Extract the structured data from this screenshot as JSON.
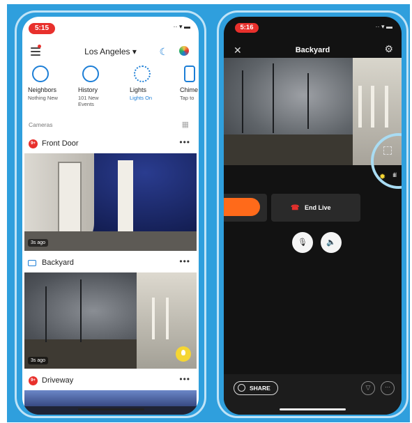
{
  "left_phone": {
    "status_time": "5:15",
    "location": "Los Angeles",
    "features": [
      {
        "name": "Neighbors",
        "sub": "Nothing New"
      },
      {
        "name": "History",
        "sub": "101 New Events"
      },
      {
        "name": "Lights",
        "sub": "Lights On"
      },
      {
        "name": "Chime",
        "sub": "Tap to"
      }
    ],
    "cameras_label": "Cameras",
    "cameras": [
      {
        "name": "Front Door",
        "badge": "9+",
        "ago": "3s ago"
      },
      {
        "name": "Backyard",
        "ago": "3s ago"
      },
      {
        "name": "Driveway",
        "badge": "9+"
      }
    ],
    "more_glyph": "•••"
  },
  "right_phone": {
    "status_time": "5:16",
    "title": "Backyard",
    "end_live_label": "End Live",
    "share_label": "SHARE"
  },
  "colors": {
    "frame_blue": "#2f9fdd",
    "ring_red": "#e8302c",
    "accent_blue": "#1c7ed6",
    "live_orange": "#ff6a1a",
    "light_yellow": "#f5d633"
  },
  "icons": [
    "menu-icon",
    "moon-icon",
    "palette-icon",
    "close-icon",
    "gear-icon",
    "fullscreen-icon",
    "sun-icon",
    "signal-icon",
    "mic-off-icon",
    "speaker-off-icon",
    "phone-hangup-icon",
    "share-icon",
    "filter-icon",
    "more-icon",
    "bulb-icon"
  ]
}
